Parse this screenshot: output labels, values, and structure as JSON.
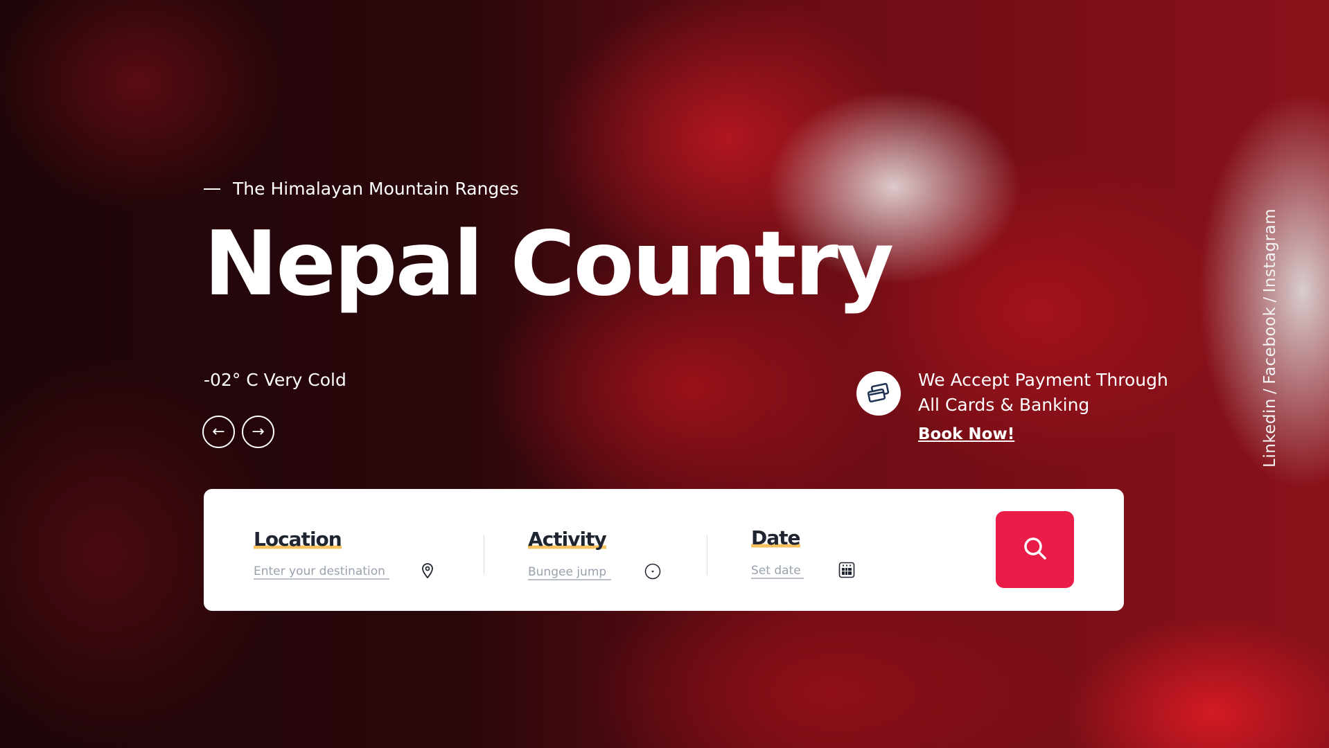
{
  "hero": {
    "tagline": "The Himalayan Mountain Ranges",
    "title": "Nepal Country",
    "temperature": "-02° C  Very Cold",
    "prev_icon": "arrow-left-icon",
    "next_icon": "arrow-right-icon"
  },
  "payment": {
    "icon": "credit-cards-icon",
    "line1": "We Accept Payment Through",
    "line2": "All Cards & Banking",
    "cta": "Book Now!"
  },
  "social": {
    "items": [
      "Linkedin",
      "Facebook",
      "Instagram"
    ],
    "separator": "/"
  },
  "search_card": {
    "location": {
      "label": "Location",
      "placeholder": "Enter your destination",
      "icon": "map-pin-icon"
    },
    "activity": {
      "label": "Activity",
      "value": "Bungee jump",
      "icon": "dropdown-circle-icon"
    },
    "date": {
      "label": "Date",
      "placeholder": "Set date",
      "icon": "calendar-icon"
    },
    "search_icon": "search-icon",
    "accent": "#e91d48",
    "highlight": "#f7c15f"
  }
}
